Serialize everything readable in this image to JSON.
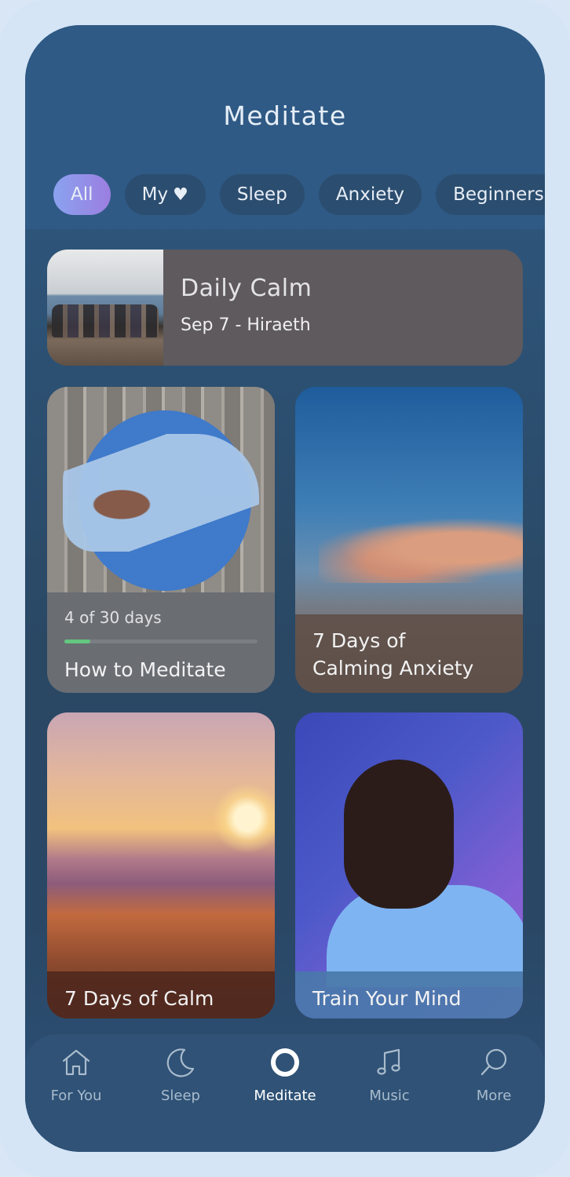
{
  "header": {
    "title": "Meditate"
  },
  "filters": [
    {
      "label": "All",
      "active": true
    },
    {
      "label": "My",
      "active": false,
      "icon": "heart-icon"
    },
    {
      "label": "Sleep",
      "active": false
    },
    {
      "label": "Anxiety",
      "active": false
    },
    {
      "label": "Beginners",
      "active": false
    }
  ],
  "daily_calm": {
    "title": "Daily Calm",
    "subtitle": "Sep 7 - Hiraeth"
  },
  "tiles": [
    {
      "title": "How to Meditate",
      "progress_text": "4 of 30 days",
      "progress": 0.133
    },
    {
      "title": "7 Days of\nCalming Anxiety"
    },
    {
      "title": "7 Days of Calm"
    },
    {
      "title": "Train Your Mind"
    }
  ],
  "tabbar": [
    {
      "label": "For You",
      "icon": "house-icon",
      "active": false
    },
    {
      "label": "Sleep",
      "icon": "moon-icon",
      "active": false
    },
    {
      "label": "Meditate",
      "icon": "circle-icon",
      "active": true
    },
    {
      "label": "Music",
      "icon": "music-note-icon",
      "active": false
    },
    {
      "label": "More",
      "icon": "search-icon",
      "active": false
    }
  ],
  "colors": {
    "active_chip_start": "#8aa2ef",
    "active_chip_end": "#9b7ee0",
    "progress_fill": "#63c77f"
  }
}
